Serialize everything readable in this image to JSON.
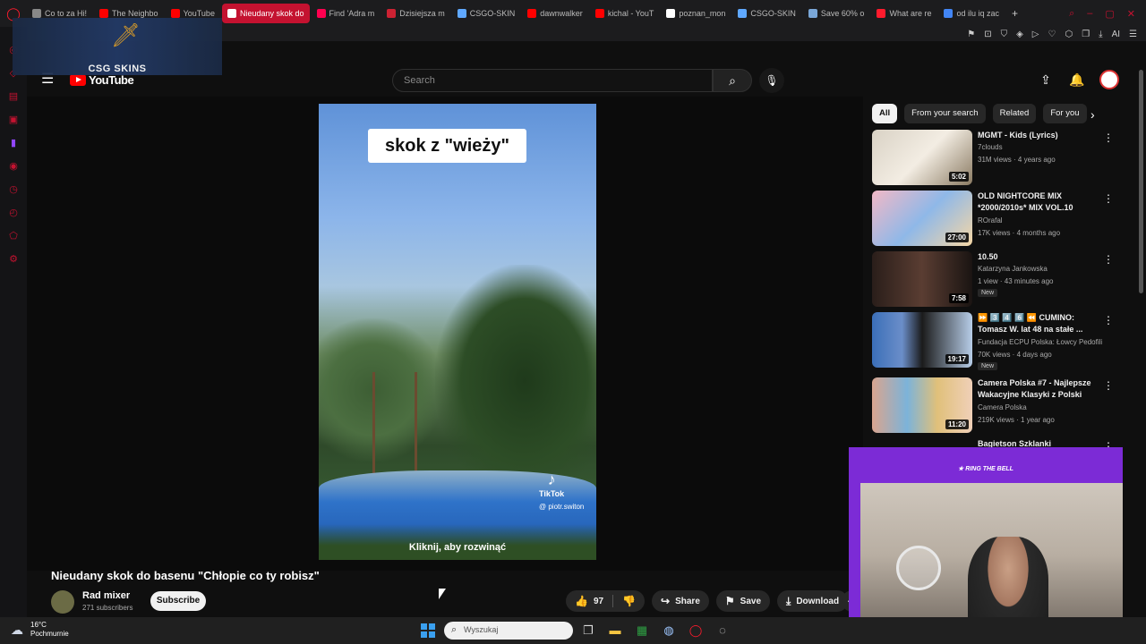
{
  "browser": {
    "tabs": [
      {
        "label": "Co to za Hi!",
        "color": "#888888",
        "active": false
      },
      {
        "label": "The Neighbo",
        "color": "#ff0000",
        "active": false
      },
      {
        "label": "YouTube",
        "color": "#ff0000",
        "active": false
      },
      {
        "label": "Nieudany skok do",
        "color": "#ffffff",
        "active": true
      },
      {
        "label": "Find 'Adra m",
        "color": "#ff0050",
        "active": false
      },
      {
        "label": "Dzisiejsza m",
        "color": "#cc2233",
        "active": false
      },
      {
        "label": "CSGO-SKIN",
        "color": "#5fa8ff",
        "active": false
      },
      {
        "label": "dawnwalker",
        "color": "#ff0000",
        "active": false
      },
      {
        "label": "kichal - YouT",
        "color": "#ff0000",
        "active": false
      },
      {
        "label": "poznan_mon",
        "color": "#ffffff",
        "active": false
      },
      {
        "label": "CSGO-SKIN",
        "color": "#5fa8ff",
        "active": false
      },
      {
        "label": "Save 60% o",
        "color": "#7aa7d8",
        "active": false
      },
      {
        "label": "What are re",
        "color": "#ff1b2d",
        "active": false
      },
      {
        "label": "od ilu iq zac",
        "color": "#4285f4",
        "active": false
      }
    ],
    "toolbar_ai": "AI"
  },
  "overlay": {
    "brand": "CSG SKINS"
  },
  "youtube": {
    "logo_text": "YouTube",
    "search_placeholder": "Search",
    "video": {
      "caption_top": "skok z \"wieży\"",
      "tiktok": "TikTok",
      "tiktok_user": "@ piotr.switon",
      "expand_text": "Kliknij, aby rozwinąć"
    },
    "title": "Nieudany skok do basenu \"Chłopie co ty robisz\"",
    "channel": {
      "name": "Rad mixer",
      "subscribers": "271 subscribers"
    },
    "subscribe_label": "Subscribe",
    "actions": {
      "likes": "97",
      "share": "Share",
      "save": "Save",
      "download": "Download"
    },
    "chips": [
      "All",
      "From your search",
      "Related",
      "For you"
    ],
    "related": [
      {
        "title": "MGMT - Kids (Lyrics)",
        "channel": "7clouds",
        "meta": "31M views · 4 years ago",
        "duration": "5:02",
        "new": "",
        "thumb": "kids"
      },
      {
        "title": "OLD NIGHTCORE MIX *2000/2010s* MIX VOL.10",
        "channel": "ROrafal",
        "meta": "17K views · 4 months ago",
        "duration": "27:00",
        "new": "",
        "thumb": "anime"
      },
      {
        "title": "10.50",
        "channel": "Katarzyna Jankowska",
        "meta": "1 view · 43 minutes ago",
        "duration": "7:58",
        "new": "New",
        "thumb": "dark"
      },
      {
        "title": "⏩ 3️⃣ 4️⃣ 6️⃣ ⏪ CUMINO: Tomasz W. lat 48 na stałe ...",
        "channel": "Fundacja ECPU Polska: Łowcy Pedofili",
        "meta": "70K views · 4 days ago",
        "duration": "19:17",
        "new": "New",
        "thumb": "blue"
      },
      {
        "title": "Camera Polska #7 - Najlepsze Wakacyjne Klasyki z Polski",
        "channel": "Camera Polska",
        "meta": "219K views · 1 year ago",
        "duration": "11:20",
        "new": "",
        "thumb": "collage"
      },
      {
        "title": "Bagietson Szklanki",
        "channel": "",
        "meta": "",
        "duration": "",
        "new": "",
        "thumb": "plain"
      }
    ]
  },
  "webcam": {
    "banner": "★ RING THE BELL"
  },
  "taskbar": {
    "temperature": "16°C",
    "condition": "Pochmurnie",
    "search_placeholder": "Wyszukaj"
  }
}
